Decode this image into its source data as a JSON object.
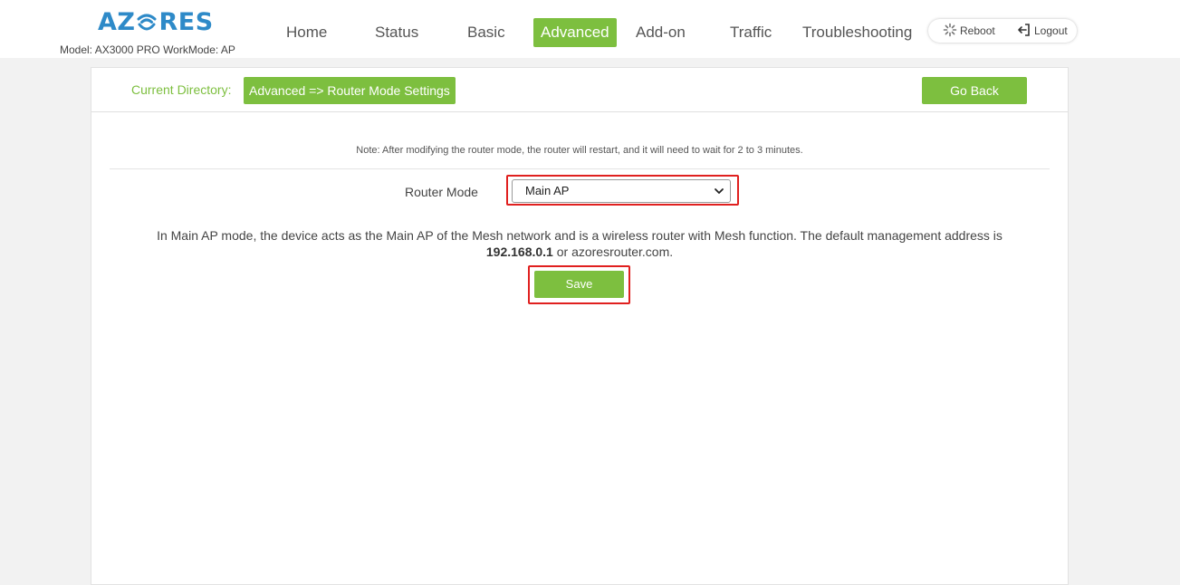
{
  "brand": {
    "logo_text_left": "AZ",
    "logo_text_right": "RES",
    "logo_o_icon": "wifi-o-icon",
    "logo_color": "#2e8ac8",
    "model_line": "Model: AX3000 PRO  WorkMode: AP"
  },
  "nav": {
    "items": [
      {
        "label": "Home"
      },
      {
        "label": "Status"
      },
      {
        "label": "Basic"
      },
      {
        "label": "Advanced",
        "active": true
      },
      {
        "label": "Add-on"
      },
      {
        "label": "Traffic"
      },
      {
        "label": "Troubleshooting"
      }
    ],
    "reboot_label": "Reboot",
    "reboot_icon": "spinner-icon",
    "logout_label": "Logout",
    "logout_icon": "logout-arrow-icon"
  },
  "directory": {
    "label": "Current Directory:",
    "path": "Advanced => Router Mode Settings",
    "go_back_label": "Go Back"
  },
  "content": {
    "note": "Note: After modifying the router mode, the router will restart, and it will need to wait for 2 to 3 minutes.",
    "router_mode_label": "Router Mode",
    "router_mode_value": "Main AP",
    "description_line1": "In Main AP mode, the device acts as the Main AP of the Mesh network and is a wireless router with Mesh function. The default management address is",
    "description_ip": "192.168.0.1",
    "description_suffix": " or azoresrouter.com.",
    "save_label": "Save"
  },
  "colors": {
    "accent_green": "#7dbf3f",
    "highlight_red": "#e0201f",
    "brand_blue": "#2e8ac8"
  }
}
